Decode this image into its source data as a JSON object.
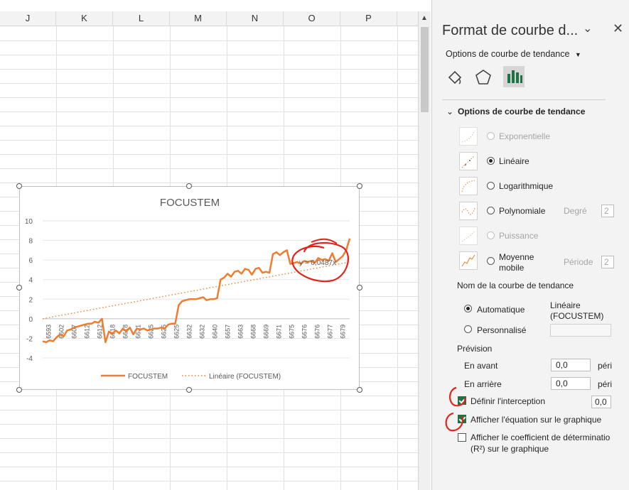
{
  "sheet": {
    "columns": [
      "J",
      "K",
      "L",
      "M",
      "N",
      "O",
      "P"
    ]
  },
  "chart": {
    "legend": {
      "series": "FOCUSTEM",
      "trend": "Linéaire (FOCUSTEM)"
    },
    "equation_label": "y = 0,0487x"
  },
  "chart_data": {
    "type": "line",
    "title": "FOCUSTEM",
    "ylim": [
      -4,
      10
    ],
    "y_ticks": [
      "-4",
      "-2",
      "0",
      "2",
      "4",
      "6",
      "8",
      "10"
    ],
    "x_tick_labels": [
      "6593",
      "6602",
      "6607",
      "6612",
      "6612",
      "6618",
      "6618",
      "6621",
      "6625",
      "6625",
      "6625",
      "6632",
      "6632",
      "6640",
      "6657",
      "6663",
      "6668",
      "6669",
      "6671",
      "6675",
      "6676",
      "6676",
      "6677",
      "6679"
    ],
    "series": [
      {
        "name": "FOCUSTEM",
        "color": "#ed7d31",
        "values": [
          -2.3,
          -2.4,
          -2.2,
          -2.3,
          -1.9,
          -1.6,
          -1.8,
          -1.2,
          -1.1,
          -0.9,
          -0.8,
          -0.7,
          -0.6,
          -0.5,
          -0.5,
          -0.3,
          -0.4,
          0.0,
          -2.4,
          -1.3,
          -1.5,
          -1.2,
          -1.5,
          -1.0,
          -1.3,
          -0.9,
          -1.6,
          -1.0,
          -1.1,
          -1.0,
          -1.2,
          -1.1,
          -1.0,
          -1.0,
          -0.9,
          -1.0,
          -0.6,
          -0.5,
          -0.5,
          1.4,
          1.8,
          1.9,
          2.0,
          2.0,
          2.0,
          2.1,
          2.2,
          1.9,
          2.0,
          2.0,
          2.1,
          4.0,
          4.2,
          4.6,
          4.3,
          4.8,
          4.9,
          4.6,
          5.1,
          5.0,
          4.5,
          5.1,
          5.2,
          4.7,
          4.8,
          4.7,
          6.6,
          6.8,
          6.5,
          6.8,
          7.0,
          5.6,
          5.7,
          5.8,
          5.6,
          5.9,
          5.8,
          5.9,
          5.7,
          6.2,
          6.0,
          6.1,
          5.9,
          6.7,
          5.8,
          6.1,
          6.4,
          7.0,
          8.2
        ]
      },
      {
        "name": "Linéaire (FOCUSTEM)",
        "color": "#ed7d31",
        "trendline": true,
        "start": 0.0,
        "end": 5.8
      }
    ]
  },
  "pane": {
    "title": "Format de courbe d...",
    "dropdown_label": "Options de courbe de tendance",
    "section_title": "Options de courbe de tendance",
    "options": {
      "exponential": "Exponentielle",
      "linear": "Linéaire",
      "logarithmic": "Logarithmique",
      "polynomial": "Polynomiale",
      "degree_label": "Degré",
      "degree_value": "2",
      "power": "Puissance",
      "moving_average": "Moyenne mobile",
      "period_label": "Période",
      "period_value": "2"
    },
    "name_section": {
      "label": "Nom de la courbe de tendance",
      "automatic": "Automatique",
      "automatic_value": "Linéaire (FOCUSTEM)",
      "custom": "Personnalisé"
    },
    "forecast": {
      "label": "Prévision",
      "forward": "En avant",
      "forward_value": "0,0",
      "forward_unit": "péri",
      "backward": "En arrière",
      "backward_value": "0,0",
      "backward_unit": "péri"
    },
    "intercept": {
      "label": "Définir l'interception",
      "value": "0,0"
    },
    "show_equation": "Afficher l'équation sur le graphique",
    "show_r2_line1": "Afficher le coefficient de déterminatio",
    "show_r2_line2": "(R²) sur le graphique"
  }
}
